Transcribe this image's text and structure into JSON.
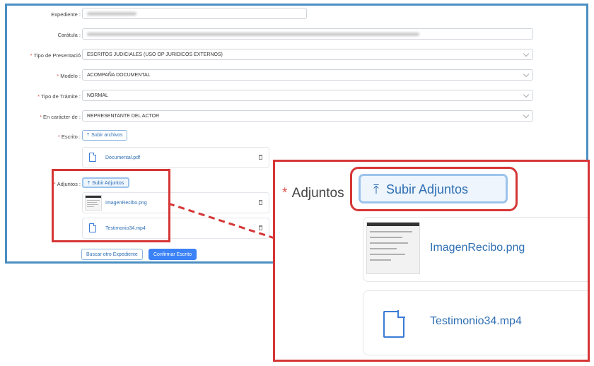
{
  "form": {
    "expediente": {
      "label": "Expediente :",
      "value": ""
    },
    "caratula": {
      "label": "Carátula :",
      "value": ""
    },
    "tipo_presentacion": {
      "label": "Tipo de Presentació",
      "value": "ESCRITOS JUDICIALES (USO OP JURIDICOS EXTERNOS)"
    },
    "modelo": {
      "label": "Modelo :",
      "value": "ACOMPAÑA DOCUMENTAL"
    },
    "tipo_tramite": {
      "label": "Tipo de Trámite :",
      "value": "NORMAL"
    },
    "caracter": {
      "label": "En carácter de :",
      "value": "REPRESENTANTE DEL ACTOR"
    },
    "escrito": {
      "label": "Escrito :",
      "button": "Subir archivos",
      "files": [
        "Documental.pdf"
      ]
    },
    "adjuntos": {
      "label": "Adjuntos :",
      "button": "Subir Adjuntos",
      "files": [
        "ImagenRecibo.png",
        "Testimonio34.mp4"
      ]
    },
    "required_mark": "*",
    "actions": {
      "buscar": "Buscar otro Expediente",
      "confirmar": "Confirmar Escrito"
    }
  },
  "zoom": {
    "label": "Adjuntos",
    "button": "Subir Adjuntos",
    "files": [
      "ImagenRecibo.png",
      "Testimonio34.mp4"
    ]
  },
  "colors": {
    "highlight": "#d63636",
    "frame": "#4a8fc2",
    "link": "#2f6fb3",
    "primary": "#3b82f6"
  },
  "icons": [
    "upload-icon",
    "file-icon",
    "trash-icon",
    "image-thumbnail"
  ]
}
